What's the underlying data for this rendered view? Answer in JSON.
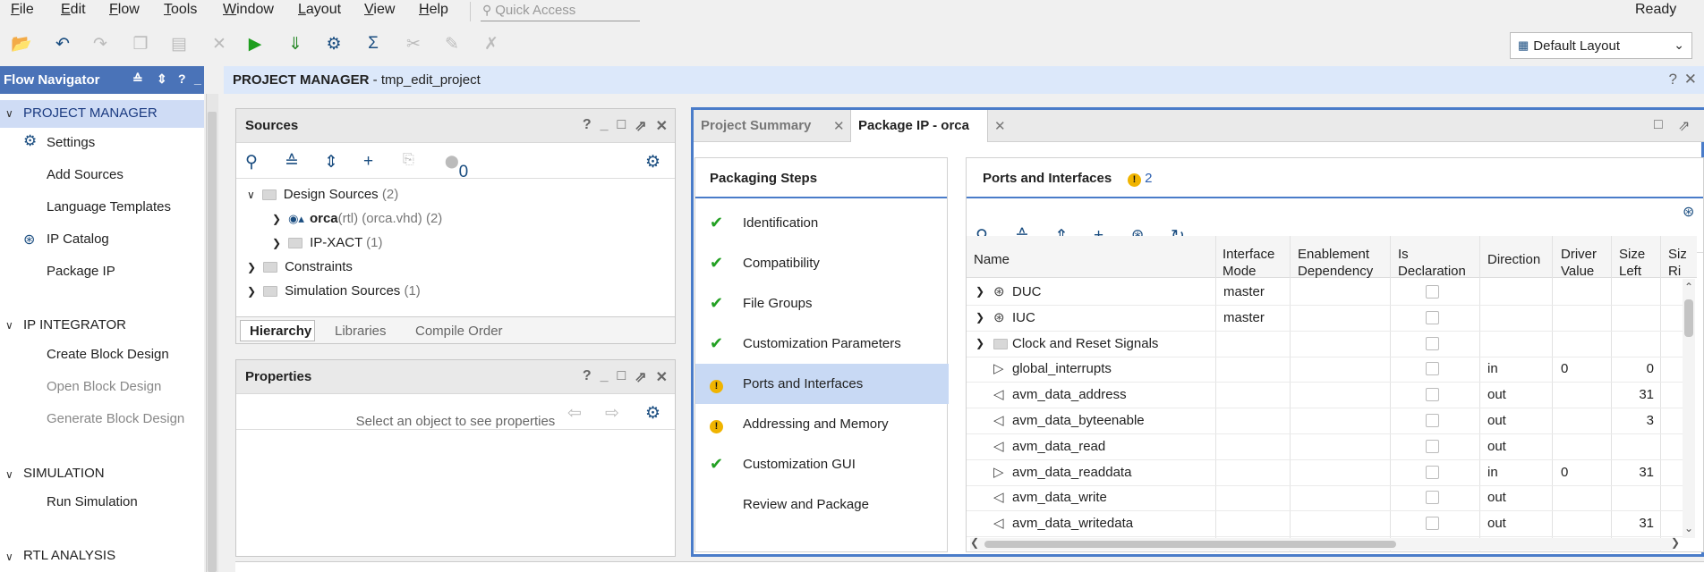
{
  "menu": {
    "items": [
      "File",
      "Edit",
      "Flow",
      "Tools",
      "Window",
      "Layout",
      "View",
      "Help"
    ],
    "quick_access_placeholder": "Quick Access",
    "status": "Ready"
  },
  "toolbar": {
    "icons": [
      "open-project-icon",
      "undo-icon",
      "redo-icon",
      "copy-icon",
      "paste-icon",
      "delete-icon",
      "run-icon",
      "run-synthesis-icon",
      "settings-icon",
      "sigma-icon",
      "cut-icon",
      "edit-icon",
      "cancel-icon"
    ],
    "layout_select": "Default Layout"
  },
  "flow_navigator": {
    "title": "Flow Navigator",
    "sections": [
      {
        "label": "PROJECT MANAGER",
        "items": [
          {
            "label": "Settings",
            "icon": "gear-icon",
            "enabled": true
          },
          {
            "label": "Add Sources",
            "enabled": true
          },
          {
            "label": "Language Templates",
            "enabled": true
          },
          {
            "label": "IP Catalog",
            "icon": "ip-icon",
            "enabled": true
          },
          {
            "label": "Package IP",
            "enabled": true
          }
        ]
      },
      {
        "label": "IP INTEGRATOR",
        "items": [
          {
            "label": "Create Block Design",
            "enabled": true
          },
          {
            "label": "Open Block Design",
            "enabled": false
          },
          {
            "label": "Generate Block Design",
            "enabled": false
          }
        ]
      },
      {
        "label": "SIMULATION",
        "items": [
          {
            "label": "Run Simulation",
            "enabled": true
          }
        ]
      },
      {
        "label": "RTL ANALYSIS",
        "items": []
      }
    ]
  },
  "project_manager": {
    "title_bold": "PROJECT MANAGER",
    "title_rest": " - tmp_edit_project"
  },
  "sources": {
    "title": "Sources",
    "badge_count": "0",
    "tree": {
      "design_sources": "Design Sources",
      "design_sources_count": "(2)",
      "orca_name": "orca",
      "orca_detail": "(rtl) (orca.vhd) (2)",
      "ipxact": "IP-XACT",
      "ipxact_count": "(1)",
      "constraints": "Constraints",
      "sim_sources": "Simulation Sources",
      "sim_sources_count": "(1)"
    },
    "tabs": [
      "Hierarchy",
      "Libraries",
      "Compile Order"
    ]
  },
  "properties": {
    "title": "Properties",
    "empty_message": "Select an object to see properties"
  },
  "package_ip": {
    "tabs": [
      "Project Summary",
      "Package IP - orca"
    ],
    "steps_title": "Packaging Steps",
    "steps": [
      {
        "label": "Identification",
        "status": "ok"
      },
      {
        "label": "Compatibility",
        "status": "ok"
      },
      {
        "label": "File Groups",
        "status": "ok"
      },
      {
        "label": "Customization Parameters",
        "status": "ok"
      },
      {
        "label": "Ports and Interfaces",
        "status": "warn"
      },
      {
        "label": "Addressing and Memory",
        "status": "warn"
      },
      {
        "label": "Customization GUI",
        "status": "ok"
      },
      {
        "label": "Review and Package",
        "status": "none"
      }
    ],
    "ports_title": "Ports and Interfaces",
    "warning_count": "2",
    "columns": [
      "Name",
      "Interface Mode",
      "Enablement Dependency",
      "Is Declaration",
      "Direction",
      "Driver Value",
      "Size Left",
      "Size Ri"
    ],
    "rows": [
      {
        "name": "DUC",
        "mode": "master",
        "dir": "",
        "driver": "",
        "left": "",
        "kind": "bus"
      },
      {
        "name": "IUC",
        "mode": "master",
        "dir": "",
        "driver": "",
        "left": "",
        "kind": "bus"
      },
      {
        "name": "Clock and Reset Signals",
        "mode": "",
        "dir": "",
        "driver": "",
        "left": "",
        "kind": "folder"
      },
      {
        "name": "global_interrupts",
        "mode": "",
        "dir": "in",
        "driver": "0",
        "left": "0",
        "kind": "in"
      },
      {
        "name": "avm_data_address",
        "mode": "",
        "dir": "out",
        "driver": "",
        "left": "31",
        "kind": "out"
      },
      {
        "name": "avm_data_byteenable",
        "mode": "",
        "dir": "out",
        "driver": "",
        "left": "3",
        "kind": "out"
      },
      {
        "name": "avm_data_read",
        "mode": "",
        "dir": "out",
        "driver": "",
        "left": "",
        "kind": "out"
      },
      {
        "name": "avm_data_readdata",
        "mode": "",
        "dir": "in",
        "driver": "0",
        "left": "31",
        "kind": "in"
      },
      {
        "name": "avm_data_write",
        "mode": "",
        "dir": "out",
        "driver": "",
        "left": "",
        "kind": "out"
      },
      {
        "name": "avm_data_writedata",
        "mode": "",
        "dir": "out",
        "driver": "",
        "left": "31",
        "kind": "out"
      }
    ]
  }
}
